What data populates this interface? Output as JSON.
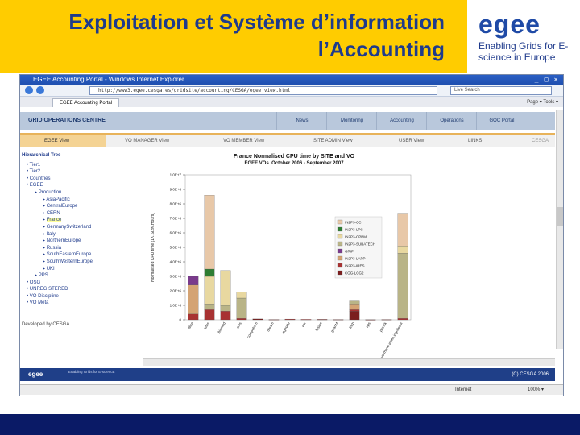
{
  "slide": {
    "title_line1": "Exploitation et Système d’information",
    "title_line2": "l’Accounting",
    "logo": "egee",
    "logo_tagline": "Enabling Grids for E-science in Europe"
  },
  "browser": {
    "title": "EGEE Accounting Portal - Windows Internet Explorer",
    "address": "http://www3.egee.cesga.es/gridsite/accounting/CESGA/egee_view.html",
    "search_placeholder": "Live Search",
    "tab_label": "EGEE Accounting Portal",
    "tools": "Page ▾  Tools ▾",
    "status_zone": "Internet",
    "status_zoom": "100% ▾"
  },
  "portal": {
    "header": "GRID OPERATIONS CENTRE",
    "nav": [
      "News",
      "Monitoring",
      "Accounting",
      "Operations",
      "GOC Portal"
    ],
    "views": [
      "EGEE View",
      "VO MANAGER View",
      "VO MEMBER View",
      "SITE ADMIN View",
      "USER View",
      "LINKS"
    ],
    "cesga": "CESGA",
    "tree_heading": "Hierarchical Tree",
    "tree": [
      {
        "label": "Tier1",
        "level": 1
      },
      {
        "label": "Tier2",
        "level": 1
      },
      {
        "label": "Countries",
        "level": 1
      },
      {
        "label": "EGEE",
        "level": 1
      },
      {
        "label": "Production",
        "level": 2
      },
      {
        "label": "AsiaPacific",
        "level": 3
      },
      {
        "label": "CentralEurope",
        "level": 3
      },
      {
        "label": "CERN",
        "level": 3
      },
      {
        "label": "France",
        "level": 3,
        "selected": true
      },
      {
        "label": "GermanySwitzerland",
        "level": 3
      },
      {
        "label": "Italy",
        "level": 3
      },
      {
        "label": "NorthernEurope",
        "level": 3
      },
      {
        "label": "Russia",
        "level": 3
      },
      {
        "label": "SouthEasternEurope",
        "level": 3
      },
      {
        "label": "SouthWesternEurope",
        "level": 3
      },
      {
        "label": "UKI",
        "level": 3
      },
      {
        "label": "PPS",
        "level": 2
      },
      {
        "label": "OSG",
        "level": 1
      },
      {
        "label": "UNREGISTERED",
        "level": 1
      },
      {
        "label": "VO Discipline",
        "level": 1
      },
      {
        "label": "VO Meta",
        "level": 1
      }
    ],
    "developed_by": "Developed by CESGA",
    "footer_brand": "egee",
    "footer_sub": "Enabling Grids for E-sciencE",
    "footer_copy": "(C) CESGA 2006"
  },
  "colors": {
    "slide_header": "#ffcc00",
    "title_text": "#1f3b8c",
    "slide_footer": "#0a1a66",
    "portal_blue": "#1f3f88",
    "view_active": "#f4d394"
  },
  "chart_data": {
    "type": "bar",
    "stacked": true,
    "title": "France Normalised CPU time by SITE and VO",
    "subtitle": "EGEE VOs. October 2006 - September 2007",
    "ylabel": "Normalised CPU time (1K.SI2K.Hours)",
    "y_ticks": [
      "0",
      "1.0E+6",
      "2.0E+6",
      "3.0E+6",
      "4.0E+6",
      "5.0E+6",
      "6.0E+6",
      "7.0E+6",
      "8.0E+6",
      "9.0E+6",
      "1.0E+7"
    ],
    "ylim": [
      0,
      10000000
    ],
    "categories": [
      "alice",
      "atlas",
      "biomed",
      "cms",
      "compchem",
      "dteam",
      "egeode",
      "esr",
      "fusion",
      "geant4",
      "lhcb",
      "ops",
      "planck",
      "vo.rhone-alpes.idgrilles.fr"
    ],
    "series": [
      {
        "name": "IN2P3-CC",
        "color": "#e8c8a8",
        "values": [
          0,
          5100000,
          0,
          0,
          0,
          0,
          0,
          0,
          0,
          0,
          0,
          0,
          0,
          2200000
        ]
      },
      {
        "name": "IN2P3-LPC",
        "color": "#2e7d32",
        "values": [
          0,
          500000,
          0,
          0,
          0,
          0,
          0,
          0,
          0,
          0,
          0,
          0,
          0,
          0
        ]
      },
      {
        "name": "IN2P3-CPPM",
        "color": "#e8d8a0",
        "values": [
          0,
          1900000,
          2400000,
          400000,
          0,
          0,
          0,
          0,
          0,
          0,
          0,
          0,
          0,
          500000
        ]
      },
      {
        "name": "IN2P3-SUBATECH",
        "color": "#b9b487",
        "values": [
          0,
          400000,
          400000,
          1400000,
          0,
          0,
          0,
          0,
          0,
          0,
          200000,
          0,
          0,
          4500000
        ]
      },
      {
        "name": "GRIF",
        "color": "#7a3a8c",
        "values": [
          600000,
          0,
          0,
          0,
          0,
          0,
          0,
          0,
          0,
          0,
          0,
          0,
          0,
          0
        ]
      },
      {
        "name": "IN2P3-LAPP",
        "color": "#d4a373",
        "values": [
          2000000,
          0,
          0,
          0,
          0,
          0,
          0,
          0,
          0,
          0,
          400000,
          0,
          0,
          0
        ]
      },
      {
        "name": "IN2P3-IRES",
        "color": "#a83232",
        "values": [
          400000,
          700000,
          600000,
          100000,
          0,
          0,
          50000,
          30000,
          0,
          0,
          100000,
          0,
          0,
          100000
        ]
      },
      {
        "name": "CGG-LCG2",
        "color": "#7b1e1e",
        "values": [
          0,
          0,
          0,
          0,
          60000,
          20000,
          0,
          0,
          30000,
          20000,
          600000,
          10000,
          20000,
          0
        ]
      }
    ],
    "legend": [
      "IN2P3-CC",
      "IN2P3-LPC",
      "IN2P3-CPPM",
      "IN2P3-SUBATECH",
      "GRIF",
      "IN2P3-LAPP",
      "IN2P3-IRES",
      "CGG-LCG2"
    ],
    "legend_position": "right"
  }
}
